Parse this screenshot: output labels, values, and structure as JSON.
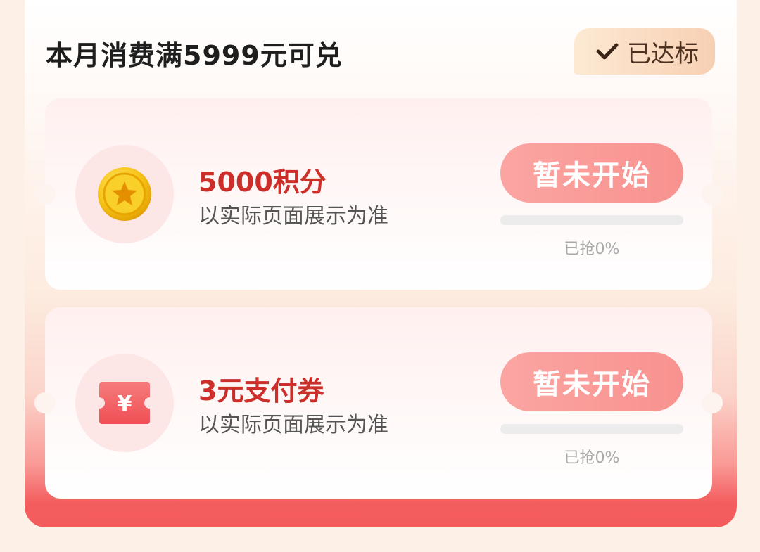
{
  "header": {
    "title": "本月消费满5999元可兑",
    "status_label": "已达标"
  },
  "rewards": [
    {
      "title": "5000积分",
      "description": "以实际页面展示为准",
      "button_label": "暂未开始",
      "progress_label": "已抢0%",
      "progress_fraction": 0,
      "icon": "gold-coin-icon"
    },
    {
      "title": "3元支付券",
      "description": "以实际页面展示为准",
      "button_label": "暂未开始",
      "progress_label": "已抢0%",
      "progress_fraction": 0,
      "icon": "coupon-icon",
      "icon_glyph": "¥"
    }
  ],
  "colors": {
    "accent_red": "#cc2e29",
    "button_pink": "#f8928f",
    "badge_bg": "#f7d0b3"
  }
}
